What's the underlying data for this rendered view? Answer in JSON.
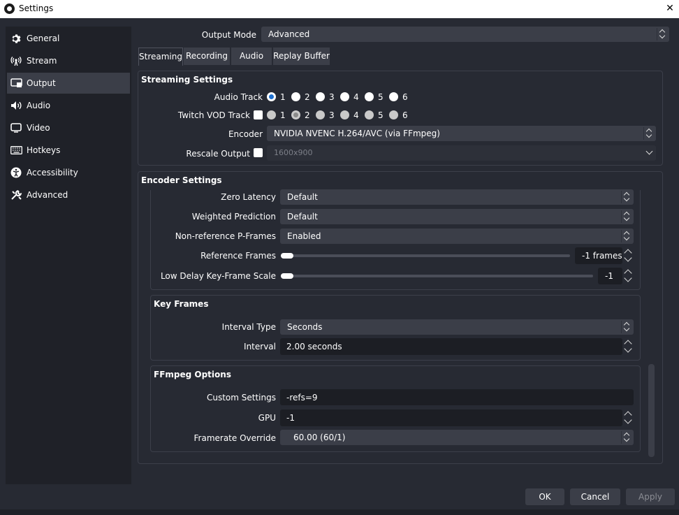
{
  "window": {
    "title": "Settings",
    "close_glyph": "✕"
  },
  "sidebar": {
    "items": [
      {
        "label": "General",
        "icon": "gear-icon"
      },
      {
        "label": "Stream",
        "icon": "broadcast-icon"
      },
      {
        "label": "Output",
        "icon": "output-icon"
      },
      {
        "label": "Audio",
        "icon": "speaker-icon"
      },
      {
        "label": "Video",
        "icon": "monitor-icon"
      },
      {
        "label": "Hotkeys",
        "icon": "keyboard-icon"
      },
      {
        "label": "Accessibility",
        "icon": "accessibility-icon"
      },
      {
        "label": "Advanced",
        "icon": "wrench-icon"
      }
    ],
    "active": "Output"
  },
  "output_mode": {
    "label": "Output Mode",
    "value": "Advanced"
  },
  "tabs": [
    {
      "label": "Streaming"
    },
    {
      "label": "Recording"
    },
    {
      "label": "Audio"
    },
    {
      "label": "Replay Buffer"
    }
  ],
  "streaming": {
    "title": "Streaming Settings",
    "audio_track": {
      "label": "Audio Track",
      "options": [
        "1",
        "2",
        "3",
        "4",
        "5",
        "6"
      ],
      "selected": "1"
    },
    "twitch_vod": {
      "label": "Twitch VOD Track",
      "options": [
        "1",
        "2",
        "3",
        "4",
        "5",
        "6"
      ],
      "selected": "2"
    },
    "encoder": {
      "label": "Encoder",
      "value": "NVIDIA NVENC H.264/AVC (via FFmpeg)"
    },
    "rescale": {
      "label": "Rescale Output",
      "value": "1600x900"
    }
  },
  "encoder_settings": {
    "title": "Encoder Settings",
    "zero_latency": {
      "label": "Zero Latency",
      "value": "Default"
    },
    "weighted_prediction": {
      "label": "Weighted Prediction",
      "value": "Default"
    },
    "non_ref_pframes": {
      "label": "Non-reference P-Frames",
      "value": "Enabled"
    },
    "reference_frames": {
      "label": "Reference Frames",
      "value": "-1 frames"
    },
    "low_delay": {
      "label": "Low Delay Key-Frame Scale",
      "value": "-1"
    }
  },
  "key_frames": {
    "title": "Key Frames",
    "interval_type": {
      "label": "Interval Type",
      "value": "Seconds"
    },
    "interval": {
      "label": "Interval",
      "value": "2.00 seconds"
    }
  },
  "ffmpeg": {
    "title": "FFmpeg Options",
    "custom": {
      "label": "Custom Settings",
      "value": "-refs=9"
    },
    "gpu": {
      "label": "GPU",
      "value": "-1"
    },
    "framerate": {
      "label": "Framerate Override",
      "value": "60.00 (60/1)"
    }
  },
  "buttons": {
    "ok": "OK",
    "cancel": "Cancel",
    "apply": "Apply"
  }
}
